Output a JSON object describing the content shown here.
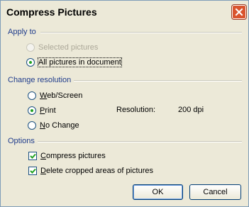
{
  "window": {
    "title": "Compress Pictures",
    "close_icon": "close-icon"
  },
  "apply_to": {
    "heading": "Apply to",
    "options": [
      {
        "label": "Selected pictures",
        "checked": false,
        "disabled": true
      },
      {
        "label": "All pictures in document",
        "checked": true,
        "disabled": false
      }
    ]
  },
  "resolution": {
    "heading": "Change resolution",
    "options": [
      {
        "label_ul": "W",
        "label_rest": "eb/Screen",
        "checked": false
      },
      {
        "label_ul": "P",
        "label_rest": "rint",
        "checked": true
      },
      {
        "label_ul": "N",
        "label_rest": "o Change",
        "checked": false
      }
    ],
    "resolution_label": "Resolution:",
    "resolution_value": "200 dpi"
  },
  "options": {
    "heading": "Options",
    "compress": {
      "label_ul": "C",
      "label_rest": "ompress pictures",
      "checked": true
    },
    "delete_cropped": {
      "label_ul": "D",
      "label_rest": "elete cropped areas of pictures",
      "checked": true
    }
  },
  "buttons": {
    "ok": "OK",
    "cancel": "Cancel"
  },
  "colors": {
    "section_heading": "#1f3c8c",
    "radio_dot": "#21a121",
    "close_button": "#d9542e"
  }
}
